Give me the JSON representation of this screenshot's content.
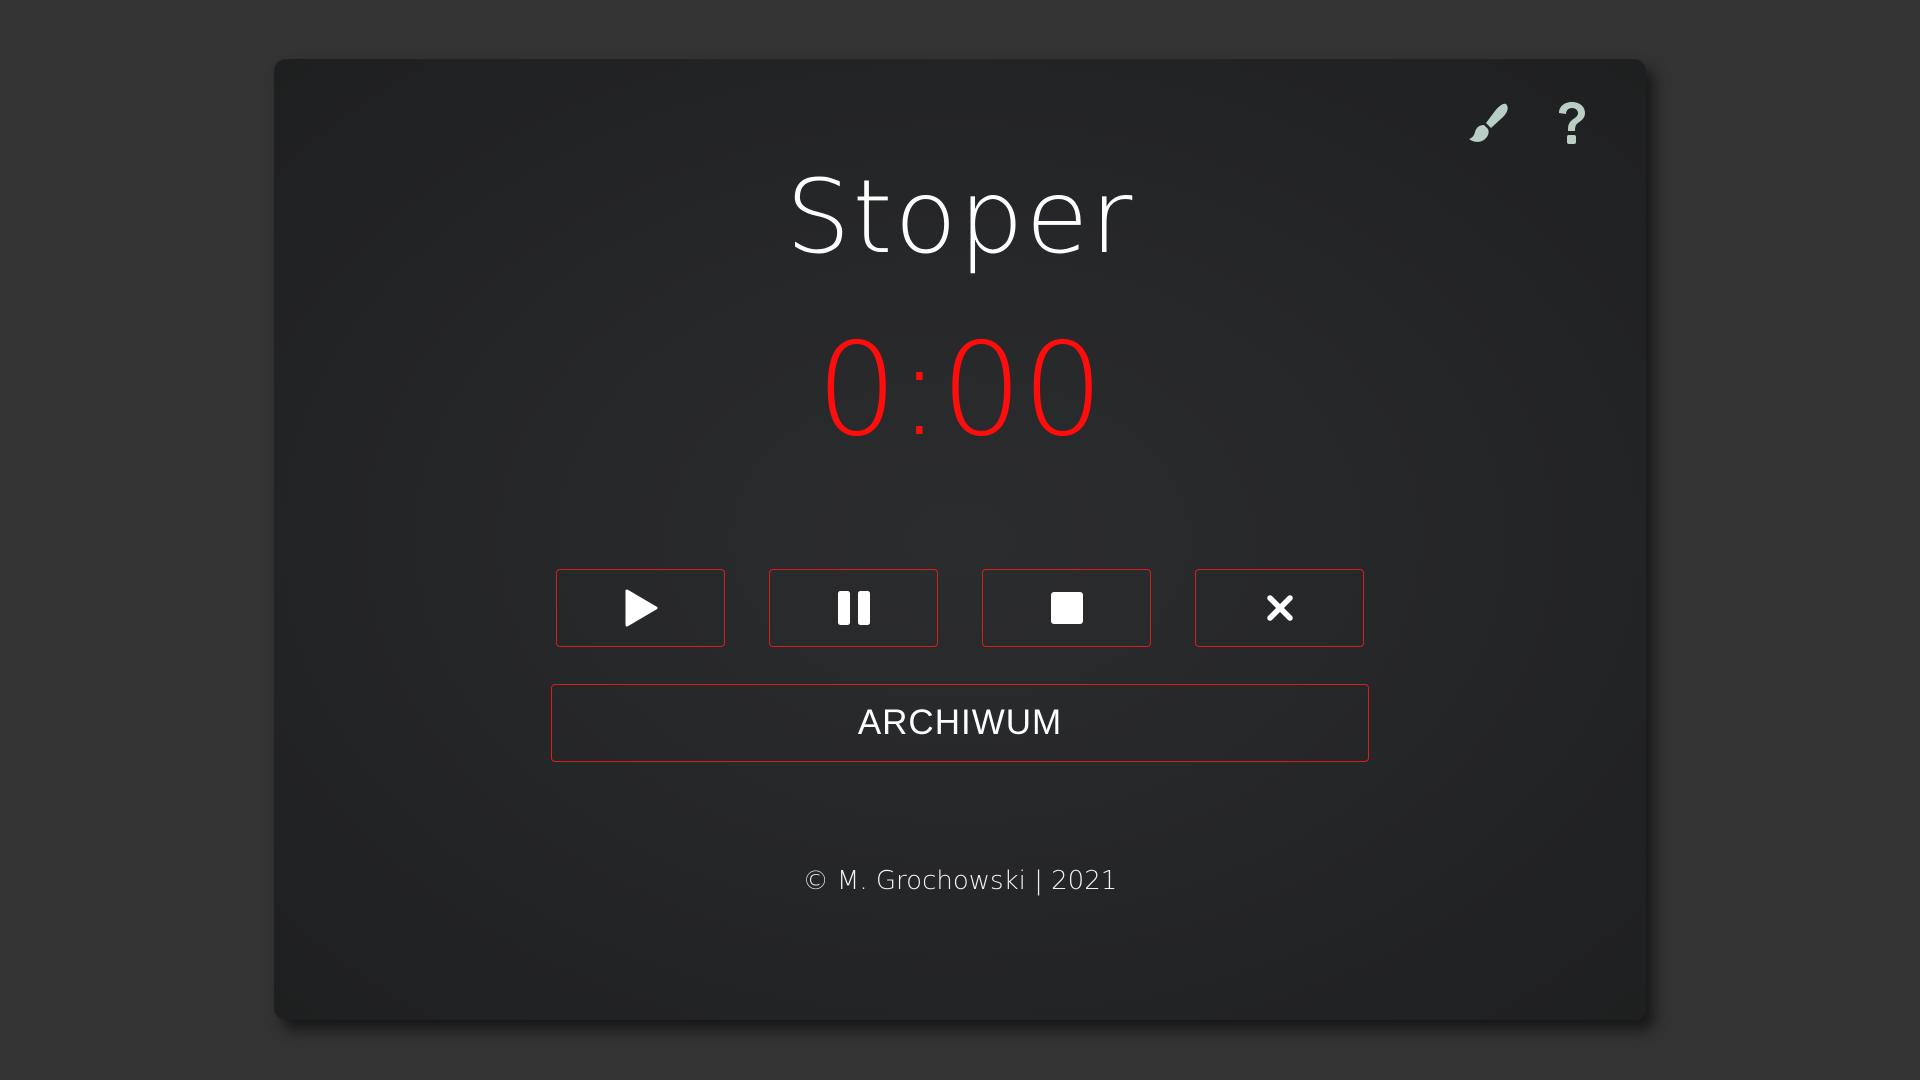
{
  "app": {
    "title": "Stoper",
    "time": "0:00"
  },
  "toolbar": {
    "theme_icon": "paintbrush-icon",
    "help_icon": "question-mark-icon"
  },
  "controls": [
    {
      "name": "start-button",
      "icon": "play-icon"
    },
    {
      "name": "pause-button",
      "icon": "pause-icon"
    },
    {
      "name": "stop-button",
      "icon": "stop-icon"
    },
    {
      "name": "reset-button",
      "icon": "close-icon"
    }
  ],
  "archive": {
    "label": "ARCHIWUM"
  },
  "footer": {
    "text": "© M. Grochowski | 2021"
  },
  "colors": {
    "background": "#333333",
    "card": "#262729",
    "accent": "#ff0d0d",
    "border": "#d91c1c",
    "icon": "#b9cfc5"
  }
}
